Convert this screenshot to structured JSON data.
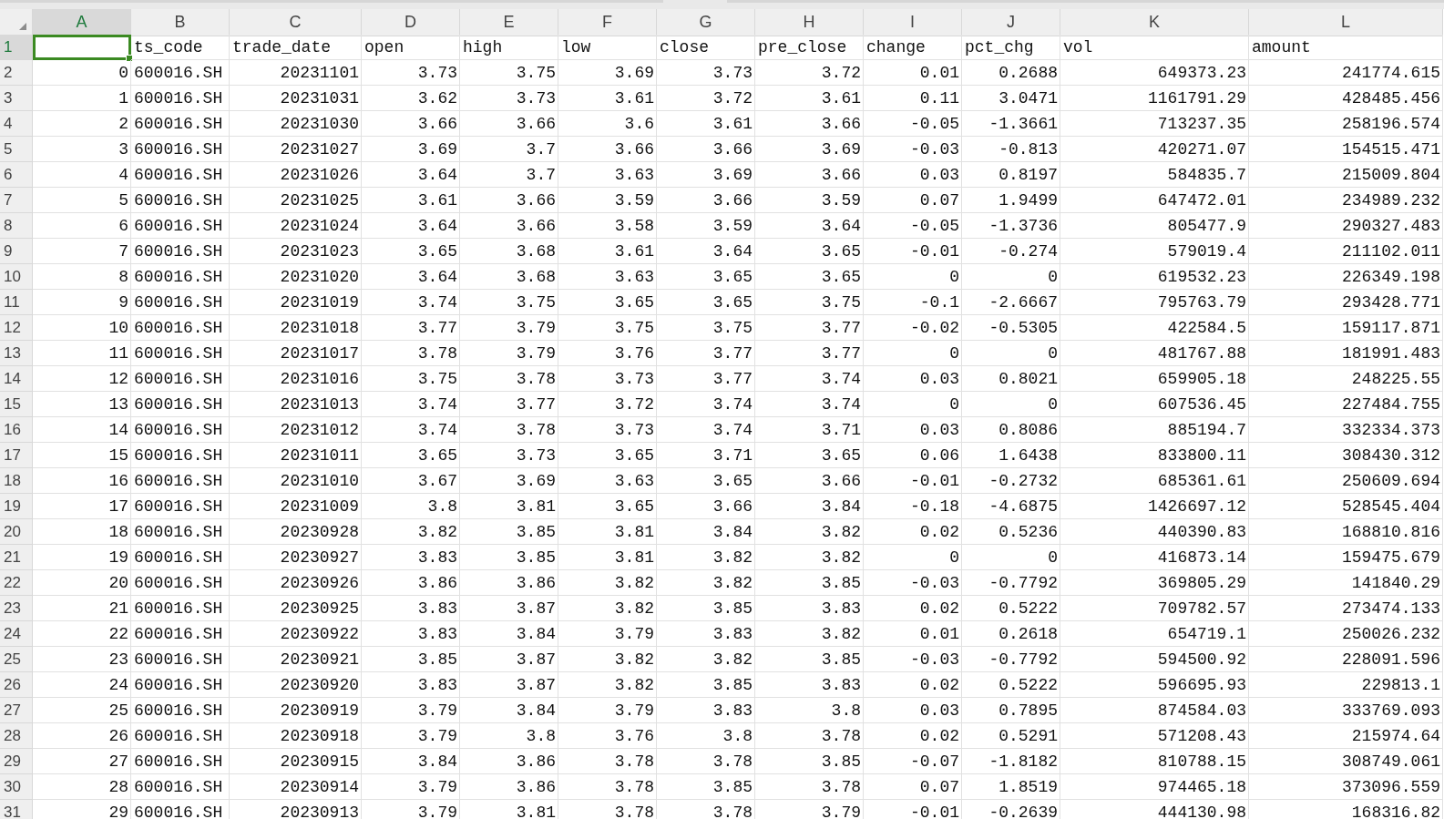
{
  "columns": [
    {
      "letter": "A",
      "selected": true,
      "kind": "number"
    },
    {
      "letter": "B",
      "selected": false,
      "kind": "text"
    },
    {
      "letter": "C",
      "selected": false,
      "kind": "number"
    },
    {
      "letter": "D",
      "selected": false,
      "kind": "number"
    },
    {
      "letter": "E",
      "selected": false,
      "kind": "number"
    },
    {
      "letter": "F",
      "selected": false,
      "kind": "number"
    },
    {
      "letter": "G",
      "selected": false,
      "kind": "number"
    },
    {
      "letter": "H",
      "selected": false,
      "kind": "number"
    },
    {
      "letter": "I",
      "selected": false,
      "kind": "number"
    },
    {
      "letter": "J",
      "selected": false,
      "kind": "number"
    },
    {
      "letter": "K",
      "selected": false,
      "kind": "number"
    },
    {
      "letter": "L",
      "selected": false,
      "kind": "number"
    }
  ],
  "rows": [
    {
      "number": "1",
      "selected": true,
      "kind": "header",
      "cells": [
        "ts_code",
        "trade_date",
        "open",
        "high",
        "low",
        "close",
        "pre_close",
        "change",
        "pct_chg",
        "vol",
        "amount"
      ]
    },
    {
      "number": "2",
      "selected": false,
      "kind": "data",
      "index": "0",
      "cells": [
        "600016.SH",
        "20231101",
        "3.73",
        "3.75",
        "3.69",
        "3.73",
        "3.72",
        "0.01",
        "0.2688",
        "649373.23",
        "241774.615"
      ]
    },
    {
      "number": "3",
      "selected": false,
      "kind": "data",
      "index": "1",
      "cells": [
        "600016.SH",
        "20231031",
        "3.62",
        "3.73",
        "3.61",
        "3.72",
        "3.61",
        "0.11",
        "3.0471",
        "1161791.29",
        "428485.456"
      ]
    },
    {
      "number": "4",
      "selected": false,
      "kind": "data",
      "index": "2",
      "cells": [
        "600016.SH",
        "20231030",
        "3.66",
        "3.66",
        "3.6",
        "3.61",
        "3.66",
        "-0.05",
        "-1.3661",
        "713237.35",
        "258196.574"
      ]
    },
    {
      "number": "5",
      "selected": false,
      "kind": "data",
      "index": "3",
      "cells": [
        "600016.SH",
        "20231027",
        "3.69",
        "3.7",
        "3.66",
        "3.66",
        "3.69",
        "-0.03",
        "-0.813",
        "420271.07",
        "154515.471"
      ]
    },
    {
      "number": "6",
      "selected": false,
      "kind": "data",
      "index": "4",
      "cells": [
        "600016.SH",
        "20231026",
        "3.64",
        "3.7",
        "3.63",
        "3.69",
        "3.66",
        "0.03",
        "0.8197",
        "584835.7",
        "215009.804"
      ]
    },
    {
      "number": "7",
      "selected": false,
      "kind": "data",
      "index": "5",
      "cells": [
        "600016.SH",
        "20231025",
        "3.61",
        "3.66",
        "3.59",
        "3.66",
        "3.59",
        "0.07",
        "1.9499",
        "647472.01",
        "234989.232"
      ]
    },
    {
      "number": "8",
      "selected": false,
      "kind": "data",
      "index": "6",
      "cells": [
        "600016.SH",
        "20231024",
        "3.64",
        "3.66",
        "3.58",
        "3.59",
        "3.64",
        "-0.05",
        "-1.3736",
        "805477.9",
        "290327.483"
      ]
    },
    {
      "number": "9",
      "selected": false,
      "kind": "data",
      "index": "7",
      "cells": [
        "600016.SH",
        "20231023",
        "3.65",
        "3.68",
        "3.61",
        "3.64",
        "3.65",
        "-0.01",
        "-0.274",
        "579019.4",
        "211102.011"
      ]
    },
    {
      "number": "10",
      "selected": false,
      "kind": "data",
      "index": "8",
      "cells": [
        "600016.SH",
        "20231020",
        "3.64",
        "3.68",
        "3.63",
        "3.65",
        "3.65",
        "0",
        "0",
        "619532.23",
        "226349.198"
      ]
    },
    {
      "number": "11",
      "selected": false,
      "kind": "data",
      "index": "9",
      "cells": [
        "600016.SH",
        "20231019",
        "3.74",
        "3.75",
        "3.65",
        "3.65",
        "3.75",
        "-0.1",
        "-2.6667",
        "795763.79",
        "293428.771"
      ]
    },
    {
      "number": "12",
      "selected": false,
      "kind": "data",
      "index": "10",
      "cells": [
        "600016.SH",
        "20231018",
        "3.77",
        "3.79",
        "3.75",
        "3.75",
        "3.77",
        "-0.02",
        "-0.5305",
        "422584.5",
        "159117.871"
      ]
    },
    {
      "number": "13",
      "selected": false,
      "kind": "data",
      "index": "11",
      "cells": [
        "600016.SH",
        "20231017",
        "3.78",
        "3.79",
        "3.76",
        "3.77",
        "3.77",
        "0",
        "0",
        "481767.88",
        "181991.483"
      ]
    },
    {
      "number": "14",
      "selected": false,
      "kind": "data",
      "index": "12",
      "cells": [
        "600016.SH",
        "20231016",
        "3.75",
        "3.78",
        "3.73",
        "3.77",
        "3.74",
        "0.03",
        "0.8021",
        "659905.18",
        "248225.55"
      ]
    },
    {
      "number": "15",
      "selected": false,
      "kind": "data",
      "index": "13",
      "cells": [
        "600016.SH",
        "20231013",
        "3.74",
        "3.77",
        "3.72",
        "3.74",
        "3.74",
        "0",
        "0",
        "607536.45",
        "227484.755"
      ]
    },
    {
      "number": "16",
      "selected": false,
      "kind": "data",
      "index": "14",
      "cells": [
        "600016.SH",
        "20231012",
        "3.74",
        "3.78",
        "3.73",
        "3.74",
        "3.71",
        "0.03",
        "0.8086",
        "885194.7",
        "332334.373"
      ]
    },
    {
      "number": "17",
      "selected": false,
      "kind": "data",
      "index": "15",
      "cells": [
        "600016.SH",
        "20231011",
        "3.65",
        "3.73",
        "3.65",
        "3.71",
        "3.65",
        "0.06",
        "1.6438",
        "833800.11",
        "308430.312"
      ]
    },
    {
      "number": "18",
      "selected": false,
      "kind": "data",
      "index": "16",
      "cells": [
        "600016.SH",
        "20231010",
        "3.67",
        "3.69",
        "3.63",
        "3.65",
        "3.66",
        "-0.01",
        "-0.2732",
        "685361.61",
        "250609.694"
      ]
    },
    {
      "number": "19",
      "selected": false,
      "kind": "data",
      "index": "17",
      "cells": [
        "600016.SH",
        "20231009",
        "3.8",
        "3.81",
        "3.65",
        "3.66",
        "3.84",
        "-0.18",
        "-4.6875",
        "1426697.12",
        "528545.404"
      ]
    },
    {
      "number": "20",
      "selected": false,
      "kind": "data",
      "index": "18",
      "cells": [
        "600016.SH",
        "20230928",
        "3.82",
        "3.85",
        "3.81",
        "3.84",
        "3.82",
        "0.02",
        "0.5236",
        "440390.83",
        "168810.816"
      ]
    },
    {
      "number": "21",
      "selected": false,
      "kind": "data",
      "index": "19",
      "cells": [
        "600016.SH",
        "20230927",
        "3.83",
        "3.85",
        "3.81",
        "3.82",
        "3.82",
        "0",
        "0",
        "416873.14",
        "159475.679"
      ]
    },
    {
      "number": "22",
      "selected": false,
      "kind": "data",
      "index": "20",
      "cells": [
        "600016.SH",
        "20230926",
        "3.86",
        "3.86",
        "3.82",
        "3.82",
        "3.85",
        "-0.03",
        "-0.7792",
        "369805.29",
        "141840.29"
      ]
    },
    {
      "number": "23",
      "selected": false,
      "kind": "data",
      "index": "21",
      "cells": [
        "600016.SH",
        "20230925",
        "3.83",
        "3.87",
        "3.82",
        "3.85",
        "3.83",
        "0.02",
        "0.5222",
        "709782.57",
        "273474.133"
      ]
    },
    {
      "number": "24",
      "selected": false,
      "kind": "data",
      "index": "22",
      "cells": [
        "600016.SH",
        "20230922",
        "3.83",
        "3.84",
        "3.79",
        "3.83",
        "3.82",
        "0.01",
        "0.2618",
        "654719.1",
        "250026.232"
      ]
    },
    {
      "number": "25",
      "selected": false,
      "kind": "data",
      "index": "23",
      "cells": [
        "600016.SH",
        "20230921",
        "3.85",
        "3.87",
        "3.82",
        "3.82",
        "3.85",
        "-0.03",
        "-0.7792",
        "594500.92",
        "228091.596"
      ]
    },
    {
      "number": "26",
      "selected": false,
      "kind": "data",
      "index": "24",
      "cells": [
        "600016.SH",
        "20230920",
        "3.83",
        "3.87",
        "3.82",
        "3.85",
        "3.83",
        "0.02",
        "0.5222",
        "596695.93",
        "229813.1"
      ]
    },
    {
      "number": "27",
      "selected": false,
      "kind": "data",
      "index": "25",
      "cells": [
        "600016.SH",
        "20230919",
        "3.79",
        "3.84",
        "3.79",
        "3.83",
        "3.8",
        "0.03",
        "0.7895",
        "874584.03",
        "333769.093"
      ]
    },
    {
      "number": "28",
      "selected": false,
      "kind": "data",
      "index": "26",
      "cells": [
        "600016.SH",
        "20230918",
        "3.79",
        "3.8",
        "3.76",
        "3.8",
        "3.78",
        "0.02",
        "0.5291",
        "571208.43",
        "215974.64"
      ]
    },
    {
      "number": "29",
      "selected": false,
      "kind": "data",
      "index": "27",
      "cells": [
        "600016.SH",
        "20230915",
        "3.84",
        "3.86",
        "3.78",
        "3.78",
        "3.85",
        "-0.07",
        "-1.8182",
        "810788.15",
        "308749.061"
      ]
    },
    {
      "number": "30",
      "selected": false,
      "kind": "data",
      "index": "28",
      "cells": [
        "600016.SH",
        "20230914",
        "3.79",
        "3.86",
        "3.78",
        "3.85",
        "3.78",
        "0.07",
        "1.8519",
        "974465.18",
        "373096.559"
      ]
    },
    {
      "number": "31",
      "selected": false,
      "kind": "data",
      "index": "29",
      "cells": [
        "600016.SH",
        "20230913",
        "3.79",
        "3.81",
        "3.78",
        "3.78",
        "3.79",
        "-0.01",
        "-0.2639",
        "444130.98",
        "168316.82"
      ]
    }
  ]
}
